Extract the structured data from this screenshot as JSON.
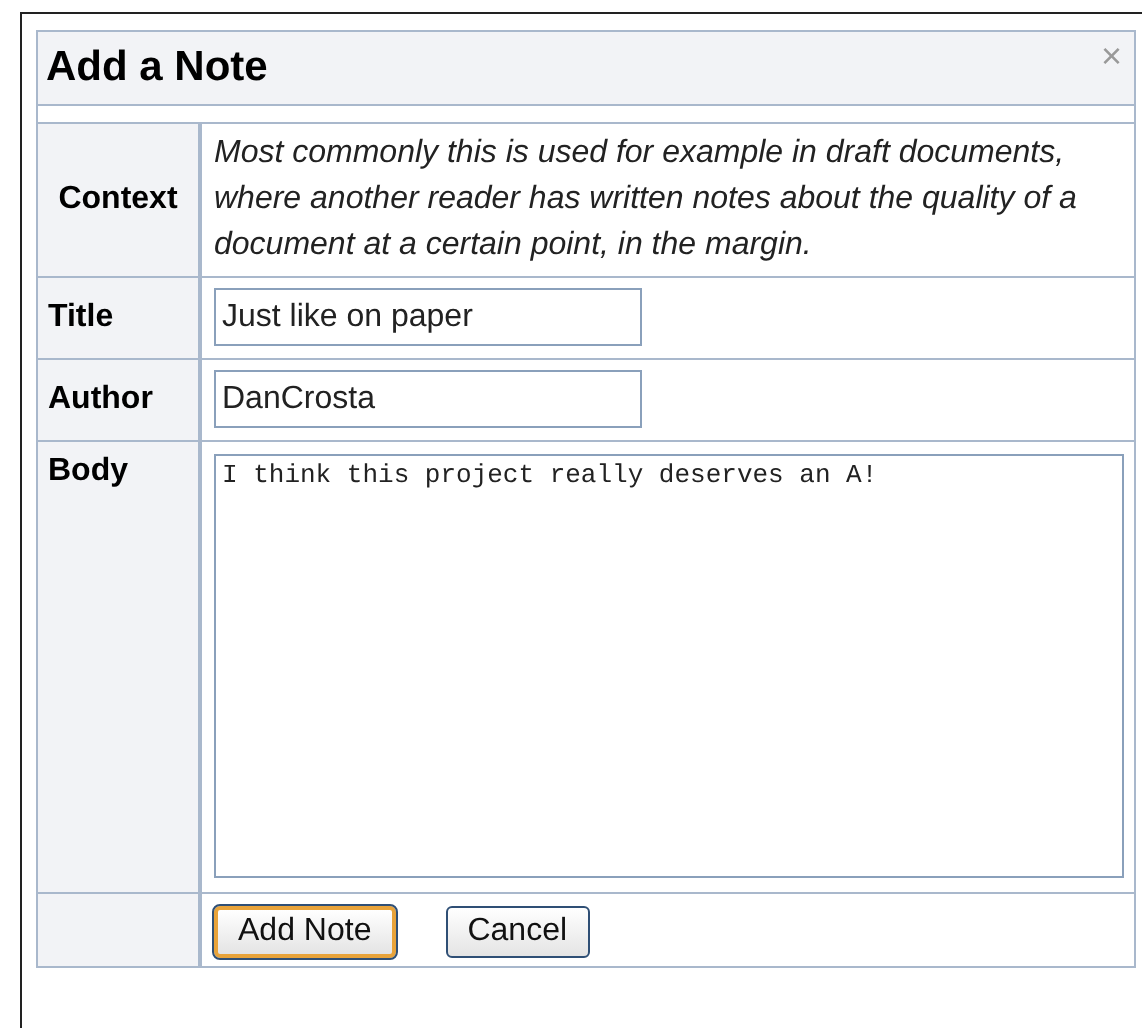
{
  "dialog": {
    "title": "Add a Note",
    "close": "×"
  },
  "rows": [
    {
      "kind": "text",
      "label": "Context",
      "text": "Most commonly this is used for example in draft documents, where another reader has written notes about the quality of a document at a certain point, in the margin."
    },
    {
      "kind": "input",
      "label": "Title",
      "value": "Just like on paper"
    },
    {
      "kind": "input",
      "label": "Author",
      "value": "DanCrosta"
    },
    {
      "kind": "textarea",
      "label": "Body",
      "value": "I think this project really deserves an A!"
    }
  ],
  "buttons": [
    {
      "label": "Add Note",
      "default": true
    },
    {
      "label": "Cancel",
      "default": false
    }
  ]
}
